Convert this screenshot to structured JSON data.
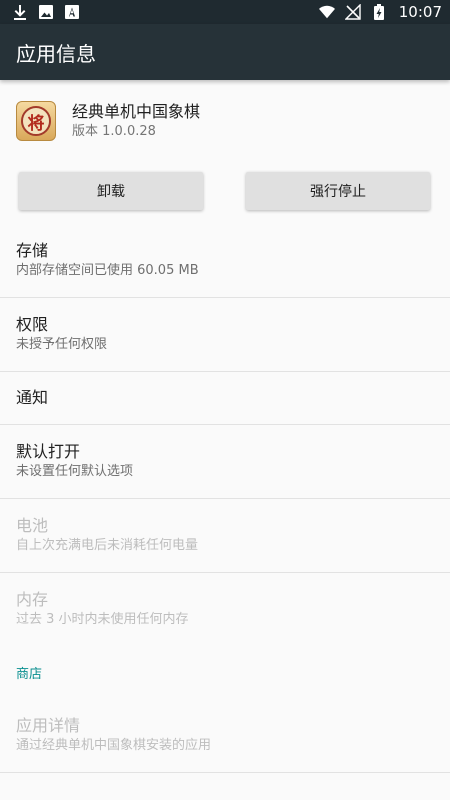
{
  "status_bar": {
    "time": "10:07",
    "left_icons": [
      "download-icon",
      "image-icon",
      "font-icon"
    ],
    "right_icons": [
      "wifi-icon",
      "no-signal-icon",
      "battery-charging-icon"
    ]
  },
  "toolbar": {
    "title": "应用信息"
  },
  "app": {
    "name": "经典单机中国象棋",
    "version": "版本 1.0.0.28",
    "icon_glyph": "将"
  },
  "buttons": {
    "uninstall": "卸载",
    "force_stop": "强行停止"
  },
  "items": {
    "storage": {
      "title": "存储",
      "subtitle": "内部存储空间已使用 60.05 MB"
    },
    "permissions": {
      "title": "权限",
      "subtitle": "未授予任何权限"
    },
    "notifications": {
      "title": "通知"
    },
    "open_by_default": {
      "title": "默认打开",
      "subtitle": "未设置任何默认选项"
    },
    "battery": {
      "title": "电池",
      "subtitle": "自上次充满电后未消耗任何电量"
    },
    "memory": {
      "title": "内存",
      "subtitle": "过去 3 小时内未使用任何内存"
    }
  },
  "store": {
    "category": "商店",
    "details": {
      "title": "应用详情",
      "subtitle": "通过经典单机中国象棋安装的应用"
    }
  },
  "colors": {
    "status_bar": "#1f2a30",
    "toolbar": "#263238",
    "accent": "#0a8f8f",
    "background": "#fafafa"
  }
}
